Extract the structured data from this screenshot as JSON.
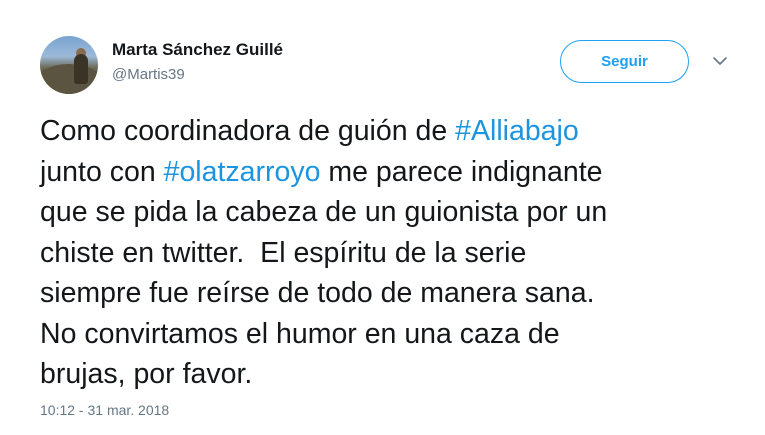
{
  "author": {
    "name": "Marta Sánchez Guillé",
    "handle": "@Martis39"
  },
  "follow_button": {
    "label": "Seguir"
  },
  "menu": {
    "icon": "chevron-down-icon"
  },
  "tweet": {
    "segments": {
      "s1": "Como coordinadora de guión de ",
      "h1": "#Alliabajo",
      "s2": "\njunto con ",
      "h2": "#olatzarroyo",
      "s3": " me parece indignante\nque se pida la cabeza de un guionista por un\nchiste en twitter.  El espíritu de la serie\nsiempre fue reírse de todo de manera sana.\nNo convirtamos el humor en una caza de\nbrujas, por favor."
    },
    "timestamp": "10:12 - 31 mar. 2018"
  },
  "colors": {
    "accent": "#1da1f2",
    "hashtag": "#1b95e0",
    "text": "#14171a",
    "muted": "#657786"
  }
}
